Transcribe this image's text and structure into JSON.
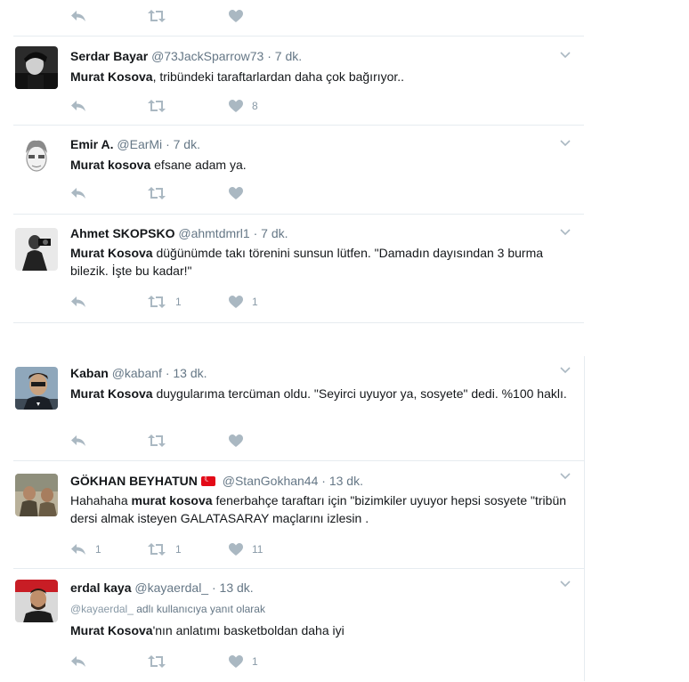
{
  "colors": {
    "icon": "#aab8c2",
    "meta": "#657786",
    "name": "#14171a",
    "divider": "#e6ecf0",
    "flag": "#e30a17"
  },
  "icons": {
    "reply": "reply-icon",
    "retweet": "retweet-icon",
    "like": "heart-icon",
    "caret": "chevron-down-icon",
    "flag": "turkey-flag-icon"
  },
  "top_actions": {
    "reply_count": "",
    "retweet_count": "",
    "like_count": ""
  },
  "tweets": [
    {
      "name": "Serdar Bayar",
      "handle": "@73JackSparrow73",
      "time": "· 7 dk.",
      "text_bold": "Murat Kosova",
      "text_rest": ", tribündeki taraftarlardan daha çok bağırıyor..",
      "reply_count": "",
      "retweet_count": "",
      "like_count": "8"
    },
    {
      "name": "Emir A.",
      "handle": "@EarMi",
      "time": "· 7 dk.",
      "text_bold": "Murat kosova",
      "text_rest": " efsane adam ya.",
      "reply_count": "",
      "retweet_count": "",
      "like_count": ""
    },
    {
      "name": "Ahmet SKOPSKO",
      "handle": "@ahmtdmrl1",
      "time": "· 7 dk.",
      "text_bold": "Murat Kosova",
      "text_rest": " düğünümde takı törenini sunsun lütfen. \"Damadın dayısından 3 burma bilezik. İşte bu kadar!\"",
      "reply_count": "",
      "retweet_count": "1",
      "like_count": "1"
    },
    {
      "name": "Kaban",
      "handle": "@kabanf",
      "time": "· 13 dk.",
      "text_bold": "Murat Kosova",
      "text_rest": " duygularıma tercüman oldu. \"Seyirci uyuyor ya, sosyete\" dedi. %100 haklı.",
      "reply_count": "",
      "retweet_count": "",
      "like_count": ""
    },
    {
      "name": "GÖKHAN BEYHATUN",
      "handle": "@StanGokhan44",
      "time": "· 13 dk.",
      "text_pre": "Hahahaha ",
      "text_bold": "murat kosova",
      "text_rest": " fenerbahçe taraftarı için \"bizimkiler uyuyor hepsi sosyete \"tribün dersi almak isteyen GALATASARAY maçlarını izlesin .",
      "reply_count": "1",
      "retweet_count": "1",
      "like_count": "11"
    },
    {
      "name": "erdal kaya",
      "handle": "@kayaerdal_",
      "time": "· 13 dk.",
      "reply_handle": "@kayaerdal_",
      "reply_suffix": " adlı kullanıcıya yanıt olarak",
      "text_bold": "Murat Kosova",
      "text_rest": "'nın anlatımı basketboldan daha iyi",
      "reply_count": "",
      "retweet_count": "",
      "like_count": "1"
    }
  ]
}
